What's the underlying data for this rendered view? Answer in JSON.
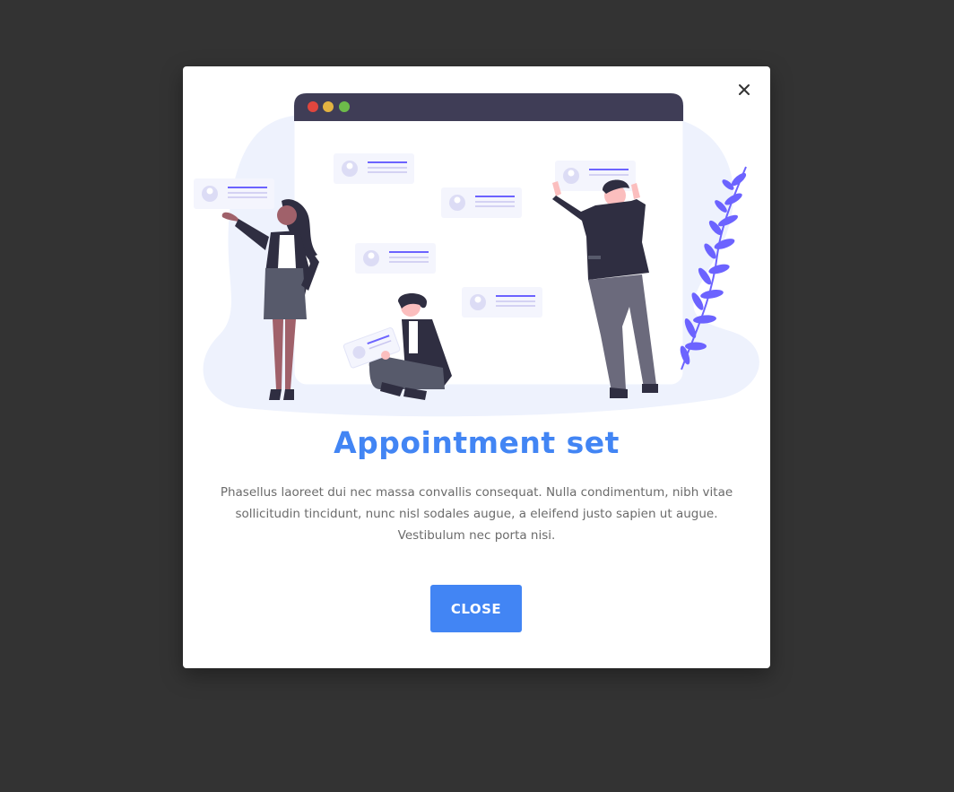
{
  "dialog": {
    "title": "Appointment set",
    "body": "Phasellus laoreet dui nec massa convallis consequat. Nulla condimentum, nibh vitae sollicitudin tincidunt, nunc nisl sodales augue, a eleifend justo sapien ut augue. Vestibulum nec porta nisi.",
    "close_button_label": "CLOSE",
    "close_icon": "close-icon"
  },
  "illustration": {
    "name": "team-collaboration-illustration",
    "colors": {
      "window_bar": "#3f3d56",
      "blob": "#eef2fd",
      "accent": "#6c63ff",
      "dot_red": "#e0463e",
      "dot_yellow": "#e3b341",
      "dot_green": "#6dbb4a"
    }
  },
  "colors": {
    "backdrop": "#333333",
    "primary": "#4285f4",
    "text": "#6b6b6b"
  }
}
